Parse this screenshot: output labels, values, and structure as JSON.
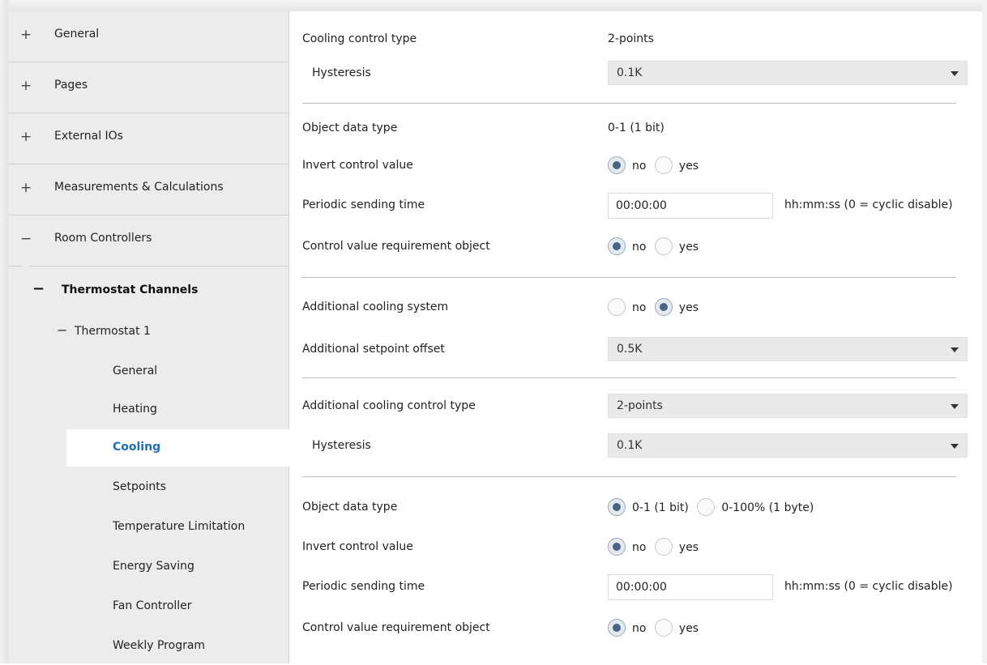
{
  "sidebar": {
    "top_items": [
      {
        "symbol": "+",
        "label": "General"
      },
      {
        "symbol": "+",
        "label": "Pages"
      },
      {
        "symbol": "+",
        "label": "External IOs"
      },
      {
        "symbol": "+",
        "label": "Measurements & Calculations"
      },
      {
        "symbol": "−",
        "label": "Room Controllers"
      }
    ],
    "section": {
      "symbol": "−",
      "label": "Thermostat Channels"
    },
    "sub": {
      "symbol": "−",
      "label": "Thermostat 1"
    },
    "leaves": [
      {
        "label": "General"
      },
      {
        "label": "Heating"
      },
      {
        "label": "Cooling",
        "active": true
      },
      {
        "label": "Setpoints"
      },
      {
        "label": "Temperature Limitation"
      },
      {
        "label": "Energy Saving"
      },
      {
        "label": "Fan Controller"
      },
      {
        "label": "Weekly Program"
      }
    ]
  },
  "main": {
    "cooling_control_type": {
      "label": "Cooling control type",
      "value": "2-points"
    },
    "hysteresis_1": {
      "label": "Hysteresis",
      "value": "0.1K"
    },
    "object_data_type_1": {
      "label": "Object data type",
      "value": "0-1 (1 bit)"
    },
    "invert_1": {
      "label": "Invert control value",
      "options": [
        "no",
        "yes"
      ],
      "selected": "no"
    },
    "periodic_1": {
      "label": "Periodic sending time",
      "value": "00:00:00",
      "unit": "hh:mm:ss (0 = cyclic disable)"
    },
    "requirement_1": {
      "label": "Control value requirement object",
      "options": [
        "no",
        "yes"
      ],
      "selected": "no"
    },
    "additional_system": {
      "label": "Additional cooling system",
      "options": [
        "no",
        "yes"
      ],
      "selected": "yes"
    },
    "additional_offset": {
      "label": "Additional setpoint offset",
      "value": "0.5K"
    },
    "additional_control_type": {
      "label": "Additional cooling control type",
      "value": "2-points"
    },
    "hysteresis_2": {
      "label": "Hysteresis",
      "value": "0.1K"
    },
    "object_data_type_2": {
      "label": "Object data type",
      "options": [
        "0-1 (1 bit)",
        "0-100% (1 byte)"
      ],
      "selected": "0-1 (1 bit)"
    },
    "invert_2": {
      "label": "Invert control value",
      "options": [
        "no",
        "yes"
      ],
      "selected": "no"
    },
    "periodic_2": {
      "label": "Periodic sending time",
      "value": "00:00:00",
      "unit": "hh:mm:ss (0 = cyclic disable)"
    },
    "requirement_2": {
      "label": "Control value requirement object",
      "options": [
        "no",
        "yes"
      ],
      "selected": "no"
    }
  },
  "colors": {
    "accent": "#1e6fb8",
    "sidebar_bg": "#ececec",
    "radio_dot": "#4b6385"
  }
}
